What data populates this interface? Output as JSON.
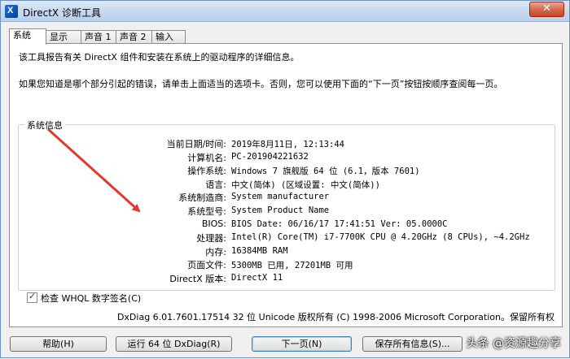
{
  "window": {
    "title": "DirectX 诊断工具",
    "close": "✕"
  },
  "tabs": [
    "系统",
    "显示",
    "声音 1",
    "声音 2",
    "输入"
  ],
  "intro": {
    "line1": "该工具报告有关 DirectX 组件和安装在系统上的驱动程序的详细信息。",
    "line2": "如果您知道是哪个部分引起的错误，请单击上面适当的选项卡。否则，您可以使用下面的“下一页”按钮按顺序查阅每一页。"
  },
  "system_info": {
    "group_label": "系统信息",
    "rows": [
      {
        "label": "当前日期/时间:",
        "value": "2019年8月11日, 12:13:44"
      },
      {
        "label": "计算机名:",
        "value": "PC-201904221632"
      },
      {
        "label": "操作系统:",
        "value": "Windows 7 旗舰版 64 位 (6.1，版本 7601)"
      },
      {
        "label": "语言:",
        "value": "中文(简体) (区域设置: 中文(简体))"
      },
      {
        "label": "系统制造商:",
        "value": "System manufacturer"
      },
      {
        "label": "系统型号:",
        "value": "System Product Name"
      },
      {
        "label": "BIOS:",
        "value": "BIOS Date: 06/16/17 17:41:51 Ver: 05.0000C"
      },
      {
        "label": "处理器:",
        "value": "Intel(R) Core(TM) i7-7700K CPU @ 4.20GHz (8 CPUs), ~4.2GHz"
      },
      {
        "label": "内存:",
        "value": "16384MB RAM"
      },
      {
        "label": "页面文件:",
        "value": "5300MB 已用, 27201MB 可用"
      },
      {
        "label": "DirectX 版本:",
        "value": "DirectX 11"
      }
    ]
  },
  "whql_checkbox": {
    "label": "检查 WHQL 数字签名(C)",
    "checked": true
  },
  "copyright": "DxDiag 6.01.7601.17514 32 位 Unicode 版权所有 (C) 1998-2006 Microsoft Corporation。保留所有权",
  "buttons": {
    "help": "帮助(H)",
    "run64": "运行 64 位 DxDiag(R)",
    "next": "下一页(N)",
    "save": "保存所有信息(S)..."
  },
  "watermark": "头条 @资源趣分享",
  "colors": {
    "arrow": "#e03a2f",
    "titlebar": "#c6d9ee",
    "close": "#c6442b"
  }
}
